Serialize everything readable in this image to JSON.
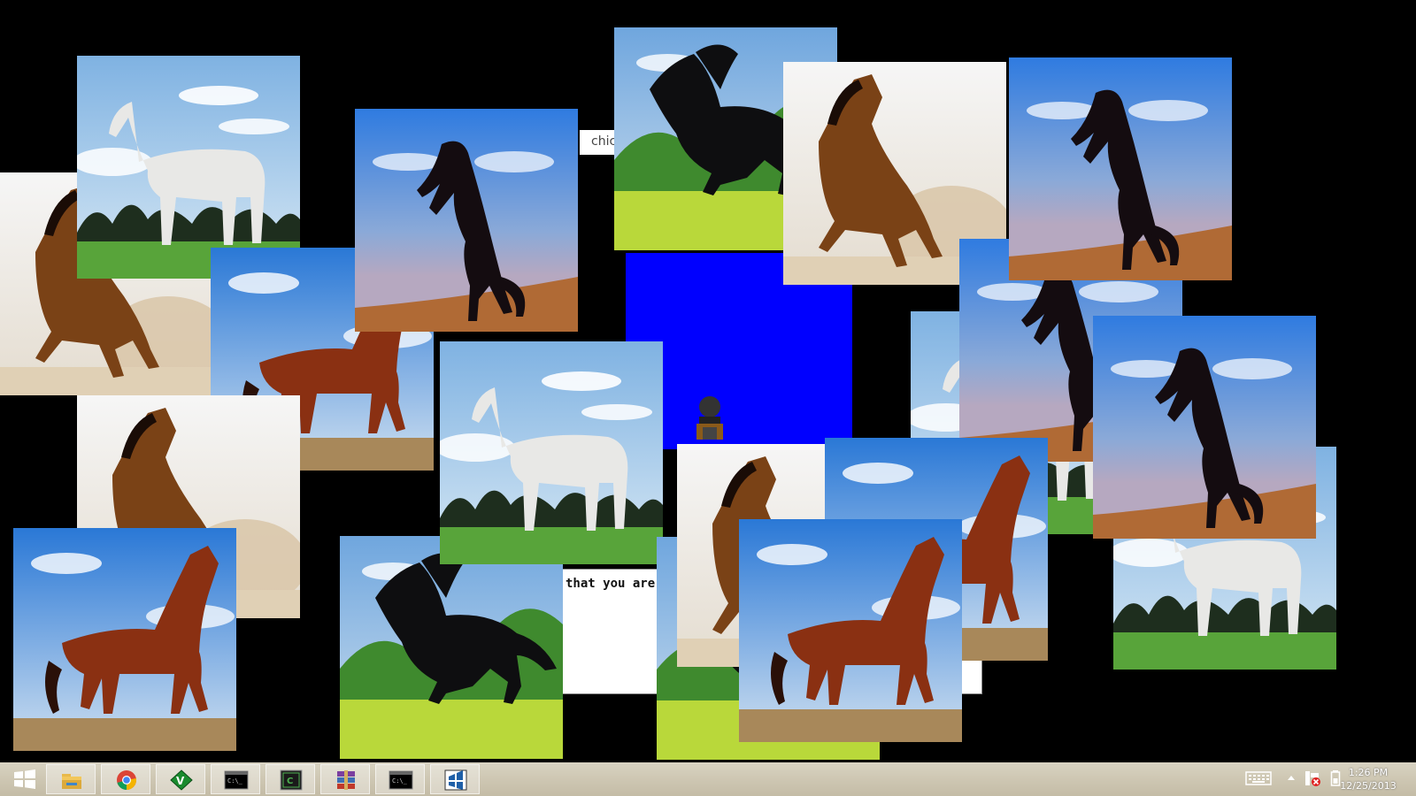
{
  "desktop": {
    "background_color": "#000000",
    "blue_window_color": "#0000ff",
    "partial_window_text": "chic",
    "terminal_text": "that you are"
  },
  "photos": [
    {
      "kind": "brown-dust"
    },
    {
      "kind": "white-horse"
    },
    {
      "kind": "chestnut-walk"
    },
    {
      "kind": "brown-dust"
    },
    {
      "kind": "black-rearing"
    },
    {
      "kind": "chestnut-walk"
    },
    {
      "kind": "black-gallop"
    },
    {
      "kind": "white-horse"
    },
    {
      "kind": "black-gallop"
    },
    {
      "kind": "brown-dust"
    },
    {
      "kind": "black-gallop"
    },
    {
      "kind": "brown-dust"
    },
    {
      "kind": "white-horse"
    },
    {
      "kind": "black-rearing"
    },
    {
      "kind": "white-horse"
    },
    {
      "kind": "black-rearing"
    },
    {
      "kind": "chestnut-walk"
    },
    {
      "kind": "black-rearing"
    },
    {
      "kind": "chestnut-walk"
    }
  ],
  "taskbar": {
    "items": [
      {
        "name": "start-button",
        "icon": "windows-logo-icon"
      },
      {
        "name": "file-explorer",
        "icon": "folder-icon"
      },
      {
        "name": "chrome",
        "icon": "chrome-icon"
      },
      {
        "name": "gvim",
        "icon": "vim-icon"
      },
      {
        "name": "command-prompt",
        "icon": "cmd-icon"
      },
      {
        "name": "console-app",
        "icon": "console-icon"
      },
      {
        "name": "winrar",
        "icon": "winrar-icon"
      },
      {
        "name": "command-prompt-2",
        "icon": "cmd-icon"
      },
      {
        "name": "app-window",
        "icon": "window-app-icon"
      }
    ],
    "time": "1:26 PM",
    "date": "12/25/2013"
  }
}
